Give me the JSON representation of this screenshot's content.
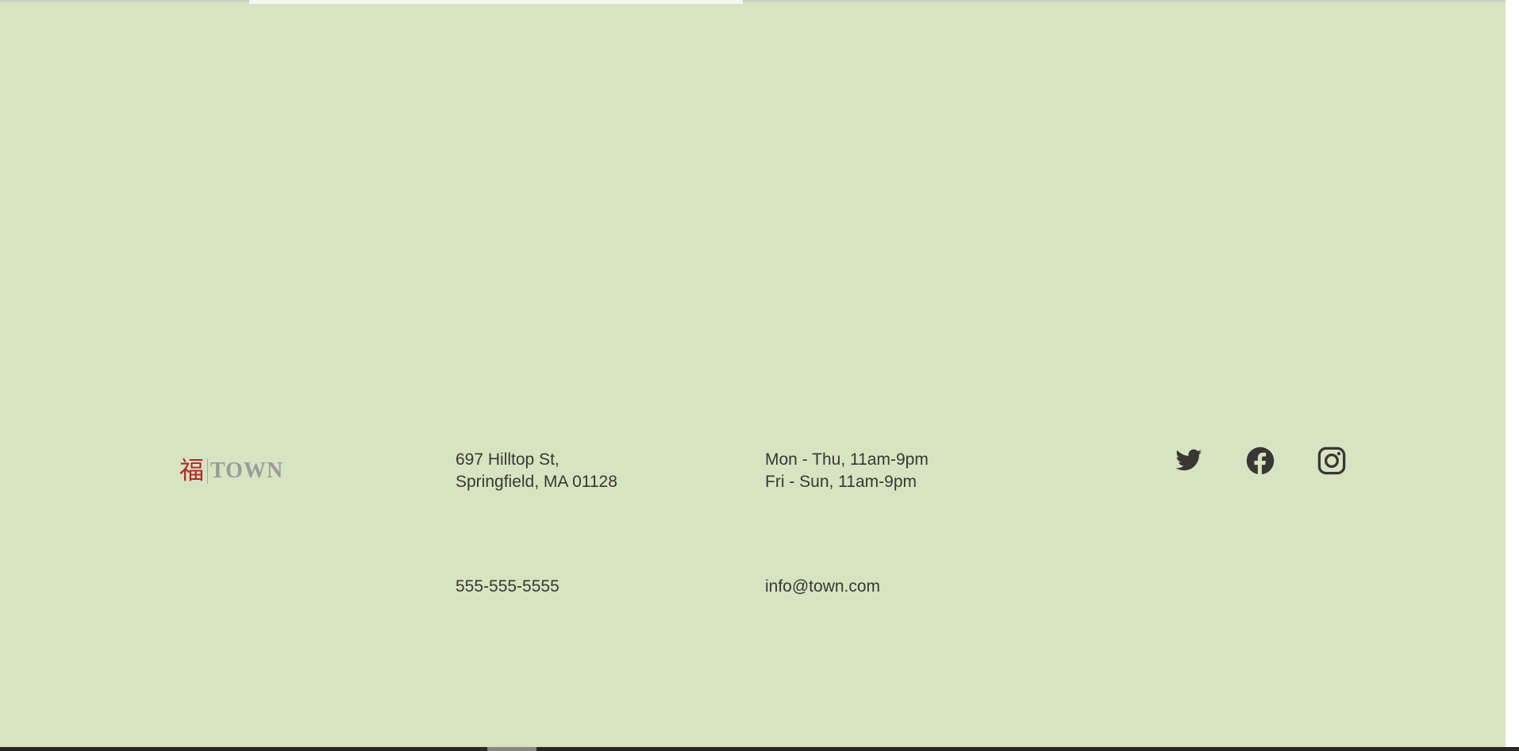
{
  "footer": {
    "logo": {
      "glyph": "福",
      "word": "TOWN"
    },
    "address": {
      "line1": "697 Hilltop St,",
      "line2": "Springfield, MA 01128"
    },
    "hours": {
      "line1": "Mon - Thu, 11am-9pm",
      "line2": "Fri - Sun, 11am-9pm"
    },
    "phone": "555-555-5555",
    "email": "info@town.com",
    "social": [
      {
        "name": "twitter-icon"
      },
      {
        "name": "facebook-icon"
      },
      {
        "name": "instagram-icon"
      }
    ],
    "colors": {
      "background": "#d7e4c1",
      "text": "#3a3634",
      "logo_red": "#b4262b",
      "logo_gray": "#9b9b9b"
    }
  }
}
